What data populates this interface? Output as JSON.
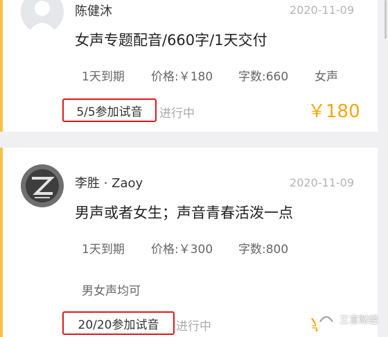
{
  "tasks": [
    {
      "user": "陈健沐",
      "date": "2020-11-09",
      "title": "女声专题配音/660字/1天交付",
      "tags": [
        "1天到期",
        "价格:￥180",
        "字数:660",
        "女声"
      ],
      "trial": "5/5参加试音",
      "status": "进行中",
      "price": "￥180"
    },
    {
      "user": "李胜 · Zaoy",
      "date": "2020-11-09",
      "title": "男声或者女生；声音青春活泼一点",
      "tags": [
        "1天到期",
        "价格:￥300",
        "字数:800",
        "男女声均可"
      ],
      "trial": "20/20参加试音",
      "status": "进行中",
      "price": "￥"
    }
  ],
  "watermark": {
    "label": "三言财经"
  },
  "colors": {
    "accent": "#f6c143",
    "price": "#f2a90f",
    "highlight": "#e0171b"
  }
}
